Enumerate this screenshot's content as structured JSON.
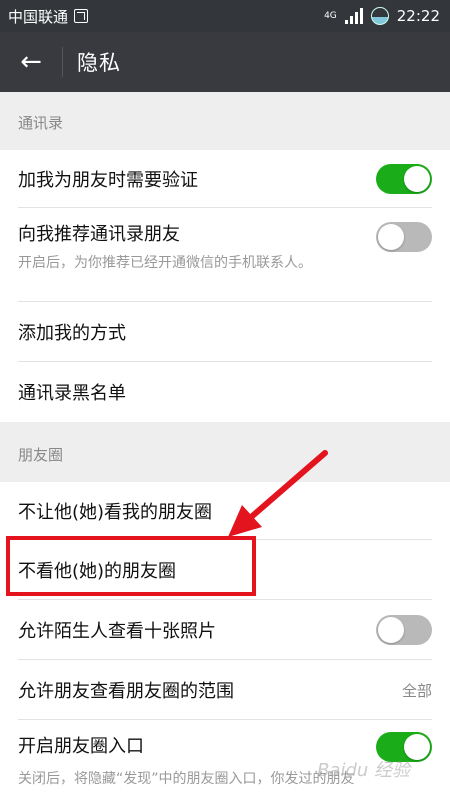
{
  "status_bar": {
    "carrier": "中国联通",
    "network": "4G",
    "time": "22:22"
  },
  "app_bar": {
    "title": "隐私",
    "back_label": "←"
  },
  "sections": {
    "contacts": {
      "header": "通讯录",
      "add_verify": {
        "label": "加我为朋友时需要验证",
        "enabled": true
      },
      "recommend": {
        "label": "向我推荐通讯录朋友",
        "hint": "开启后，为你推荐已经开通微信的手机联系人。",
        "enabled": false
      },
      "add_methods": {
        "label": "添加我的方式"
      },
      "blacklist": {
        "label": "通讯录黑名单"
      }
    },
    "moments": {
      "header": "朋友圈",
      "hide_my_moments": {
        "label": "不让他(她)看我的朋友圈"
      },
      "dont_see_their_moments": {
        "label": "不看他(她)的朋友圈"
      },
      "stranger_photos": {
        "label": "允许陌生人查看十张照片",
        "enabled": false
      },
      "visible_range": {
        "label": "允许朋友查看朋友圈的范围",
        "value": "全部"
      },
      "moments_entry": {
        "label": "开启朋友圈入口",
        "hint": "关闭后，将隐藏“发现”中的朋友圈入口，你发过的朋友",
        "enabled": true
      }
    }
  },
  "colors": {
    "toggle_on": "#1aad19",
    "toggle_off": "#b9b9b9",
    "annotation": "#e3141d",
    "appbar": "#393a3f"
  },
  "watermark": "Baidu 经验"
}
